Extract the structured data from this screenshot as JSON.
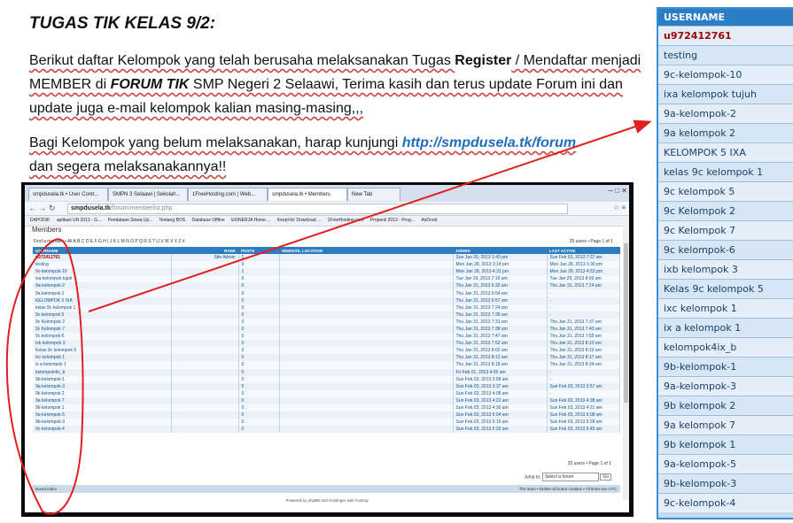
{
  "doc": {
    "title": "TUGAS TIK KELAS 9/2:",
    "p1_a": "Berikut daftar Kelompok yang telah berusaha melaksanakan Tugas ",
    "p1_b": "Register",
    "p1_c": " / Mendaftar menjadi MEMBER di ",
    "p1_d": "FORUM TIK",
    "p1_e": " SMP Negeri 2 Selaawi, Terima kasih dan terus update Forum ini dan update juga e-mail kelompok kalian masing-masing,,,",
    "p2_a": "Bagi Kelompok yang belum melaksanakan, harap kunjungi ",
    "p2_url": "http://smpdusela.tk/forum",
    "p2_b": " dan segera melaksanakannya!!"
  },
  "browser": {
    "tabs": [
      "smpdusela.tk • User Contr...",
      "SMPN 3 Selaawi | Sekolah...",
      "1FreeHosting.com | Web...",
      "smpdusela.tk • Members",
      "New Tab"
    ],
    "url_host": "smpdusela.tk",
    "url_path": "/forum/memberlist.php",
    "bookmarks": [
      "DAPODIK",
      "aplikasi UN 2013 - G...",
      "Pendataan Siswa Uji...",
      "Tentang BOS",
      "Database Offline",
      "EKINERJA Home ...",
      "KeepVid: Download ...",
      "1FreeHosting.com",
      "Propenil 2012 - Prog...",
      "AirDroid"
    ],
    "heading": "Members",
    "alpha_label": "Find a member • All  A  B  C  D  E  F  G  H  I  J  K  L  M  N  O  P  Q  R  S  T  U  V  W  X  Y  Z  #",
    "count_top": "25 users • Page 1 of 1",
    "columns": [
      "USERNAME",
      "RANK",
      "POSTS",
      "WEBSITE, LOCATION",
      "JOINED",
      "LAST ACTIVE"
    ],
    "rows": [
      [
        "u972412761",
        "Site Admin",
        "1",
        "",
        "Sun Jan 20, 2013 1:43 pm",
        "Sun Feb 03, 2013 7:37 am"
      ],
      [
        "testing",
        "",
        "0",
        "",
        "Mon Jan 28, 2013 3:14 pm",
        "Mon Jan 28, 2013 3:30 pm"
      ],
      [
        "9c-kelompok-10",
        "",
        "1",
        "",
        "Mon Jan 28, 2013 4:31 pm",
        "Mon Jan 28, 2013 4:53 pm"
      ],
      [
        "ixa kelompok tujuh",
        "",
        "0",
        "",
        "Tue Jan 29, 2013 7:10 am",
        "Tue Jan 29, 2013 8:00 am"
      ],
      [
        "9a-kelompok-2",
        "",
        "0",
        "",
        "Thu Jan 31, 2013 6:32 am",
        "Thu Jan 31, 2013 7:14 am"
      ],
      [
        "9a kelompok 2",
        "",
        "0",
        "",
        "Thu Jan 31, 2013 6:54 am",
        "-"
      ],
      [
        "KELOMPOK 5 IXA",
        "",
        "0",
        "",
        "Thu Jan 31, 2013 6:57 am",
        "-"
      ],
      [
        "kelas 9c kelompok 1",
        "",
        "0",
        "",
        "Thu Jan 31, 2013 7:24 am",
        "-"
      ],
      [
        "9c kelompok 5",
        "",
        "0",
        "",
        "Thu Jan 31, 2013 7:28 am",
        "-"
      ],
      [
        "9c Kelompok 2",
        "",
        "0",
        "",
        "Thu Jan 31, 2013 7:31 am",
        "Thu Jan 31, 2013 7:37 am"
      ],
      [
        "9c Kelompok 7",
        "",
        "0",
        "",
        "Thu Jan 31, 2013 7:38 am",
        "Thu Jan 31, 2013 7:43 am"
      ],
      [
        "9c kelompok-6",
        "",
        "0",
        "",
        "Thu Jan 31, 2013 7:47 am",
        "Thu Jan 31, 2013 7:55 am"
      ],
      [
        "ixb kelompok 3",
        "",
        "0",
        "",
        "Thu Jan 31, 2013 7:52 am",
        "Thu Jan 31, 2013 8:10 am"
      ],
      [
        "Kelas 9c kelompok 5",
        "",
        "0",
        "",
        "Thu Jan 31, 2013 8:02 am",
        "Thu Jan 31, 2013 8:13 am"
      ],
      [
        "ixc kelompok 1",
        "",
        "0",
        "",
        "Thu Jan 31, 2013 8:12 am",
        "Thu Jan 31, 2013 8:17 am"
      ],
      [
        "ix a kelompok 1",
        "",
        "0",
        "",
        "Thu Jan 31, 2013 8:18 am",
        "Thu Jan 31, 2013 8:24 am"
      ],
      [
        "kelompok4ix_b",
        "",
        "0",
        "",
        "Fri Feb 01, 2013 4:05 am",
        "-"
      ],
      [
        "9b-kelompok-1",
        "",
        "0",
        "",
        "Sun Feb 03, 2013 2:58 am",
        "-"
      ],
      [
        "9a-kelompok-3",
        "",
        "0",
        "",
        "Sun Feb 03, 2013 3:37 am",
        "Sun Feb 03, 2013 3:57 am"
      ],
      [
        "9b kelompok 2",
        "",
        "0",
        "",
        "Sun Feb 03, 2013 4:08 am",
        "-"
      ],
      [
        "9a kelompok 7",
        "",
        "0",
        "",
        "Sun Feb 03, 2013 4:22 am",
        "Sun Feb 03, 2013 4:38 am"
      ],
      [
        "9b kelompok 1",
        "",
        "0",
        "",
        "Sun Feb 03, 2013 4:30 am",
        "Sun Feb 03, 2013 4:31 am"
      ],
      [
        "9a-kelompok-5",
        "",
        "0",
        "",
        "Sun Feb 03, 2013 5:04 am",
        "Sun Feb 03, 2013 5:08 am"
      ],
      [
        "9b-kelompok-3",
        "",
        "0",
        "",
        "Sun Feb 03, 2013 5:19 am",
        "Sun Feb 03, 2013 5:28 am"
      ],
      [
        "9c-kelompok-4",
        "",
        "0",
        "",
        "Sun Feb 03, 2013 5:33 am",
        "Sun Feb 03, 2013 5:45 am"
      ]
    ],
    "count_bottom": "25 users • Page 1 of 1",
    "jump_label": "Jump to:",
    "jump_value": "Select a forum",
    "jump_go": "Go",
    "nav_left": "Board index",
    "nav_right": "The team • Delete all board cookies • All times are UTC",
    "powered": "Powered by phpBB and Hostinger web hosting"
  },
  "side": {
    "header": "USERNAME",
    "names": [
      "u972412761",
      "testing",
      "9c-kelompok-10",
      "ixa kelompok tujuh",
      "9a-kelompok-2",
      "9a kelompok 2",
      "KELOMPOK 5 IXA",
      "kelas 9c kelompok 1",
      "9c kelompok 5",
      "9c Kelompok 2",
      "9c Kelompok 7",
      "9c kelompok-6",
      "ixb kelompok 3",
      "Kelas 9c kelompok 5",
      "ixc kelompok 1",
      "ix a kelompok 1",
      "kelompok4ix_b",
      "9b-kelompok-1",
      "9a-kelompok-3",
      "9b kelompok 2",
      "9a kelompok 7",
      "9b kelompok 1",
      "9a-kelompok-5",
      "9b-kelompok-3",
      "9c-kelompok-4"
    ]
  },
  "colors": {
    "annotation": "#e02020",
    "accent": "#2b7ec4",
    "link": "#1f6ebd"
  }
}
